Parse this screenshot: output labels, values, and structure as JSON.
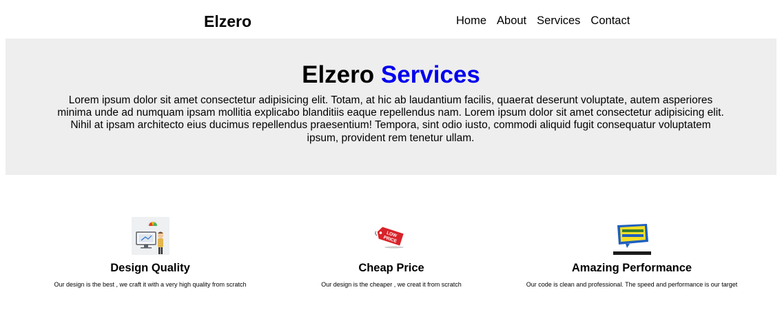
{
  "header": {
    "logo": "Elzero",
    "nav": [
      "Home",
      "About",
      "Services",
      "Contact"
    ]
  },
  "hero": {
    "title_main": "Elzero",
    "title_accent": "Services",
    "text": "Lorem ipsum dolor sit amet consectetur adipisicing elit. Totam, at hic ab laudantium facilis, quaerat deserunt voluptate, autem asperiores minima unde ad numquam ipsam mollitia explicabo blanditiis eaque repellendus nam. Lorem ipsum dolor sit amet consectetur adipisicing elit. Nihil at ipsam architecto eius ducimus repellendus praesentium! Tempora, sint odio iusto, commodi aliquid fugit consequatur voluptatem ipsum, provident rem tenetur ullam."
  },
  "features": [
    {
      "icon": "design-quality-icon",
      "title": "Design Quality",
      "text": "Our design is the best , we craft it with a very high quality from scratch"
    },
    {
      "icon": "low-price-tag-icon",
      "title": "Cheap Price",
      "text": "Our design is the cheaper , we creat it from scratch"
    },
    {
      "icon": "amazing-performance-icon",
      "title": "Amazing Performance",
      "text": "Our code is clean and professional. The speed and performance is our target"
    }
  ],
  "colors": {
    "accent": "#0000ee",
    "hero_background": "#eeeeee",
    "price_tag": "#d8232a"
  }
}
